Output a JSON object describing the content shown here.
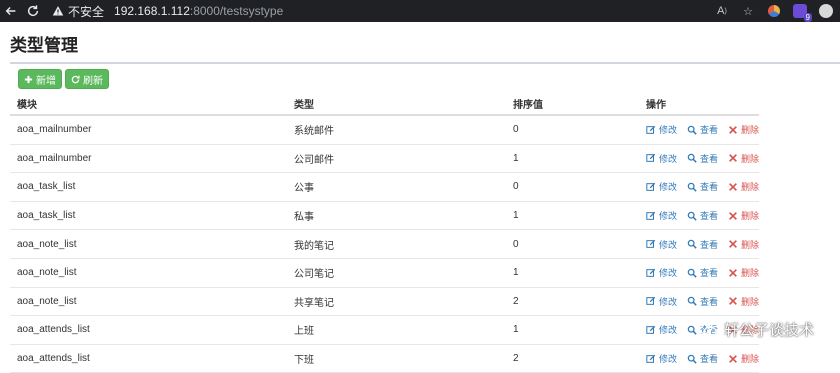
{
  "browser": {
    "insecure_label": "不安全",
    "url_host": "192.168.1.112",
    "url_rest": ":8000/testsystype",
    "ext_badge_count": "9"
  },
  "page": {
    "title": "类型管理",
    "buttons": {
      "add": "新增",
      "refresh": "刷新"
    }
  },
  "table": {
    "headers": [
      "模块",
      "类型",
      "排序值",
      "操作"
    ],
    "actions": {
      "edit": "修改",
      "view": "查看",
      "delete": "删除"
    },
    "rows": [
      [
        "aoa_mailnumber",
        "系统邮件",
        "0"
      ],
      [
        "aoa_mailnumber",
        "公司邮件",
        "1"
      ],
      [
        "aoa_task_list",
        "公事",
        "0"
      ],
      [
        "aoa_task_list",
        "私事",
        "1"
      ],
      [
        "aoa_note_list",
        "我的笔记",
        "0"
      ],
      [
        "aoa_note_list",
        "公司笔记",
        "1"
      ],
      [
        "aoa_note_list",
        "共享笔记",
        "2"
      ],
      [
        "aoa_attends_list",
        "上班",
        "1"
      ],
      [
        "aoa_attends_list",
        "下班",
        "2"
      ]
    ]
  },
  "watermark": {
    "text": "轩公子谈技术"
  },
  "colors": {
    "success": "#5cb85c",
    "link": "#337ab7",
    "danger": "#d9534f"
  }
}
